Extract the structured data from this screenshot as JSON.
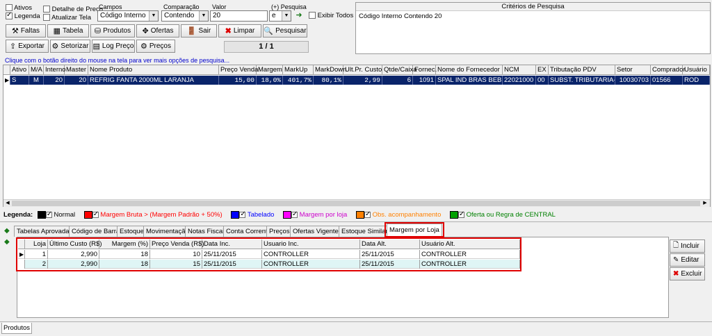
{
  "filters": {
    "ativos": "Ativos",
    "legenda": "Legenda",
    "detalhe_preco": "Detalhe de Preço",
    "atualizar_tela": "Atualizar Tela",
    "campos_label": "Campos",
    "campos_value": "Código Interno",
    "comparacao_label": "Comparação",
    "comparacao_value": "Contendo",
    "valor_label": "Valor",
    "valor_value": "20",
    "pesquisa_label": "(+) Pesquisa",
    "pesquisa_value": "e",
    "exibir_todos": "Exibir Todos"
  },
  "toolbar": {
    "faltas": "Faltas",
    "tabela": "Tabela",
    "produtos": "Produtos",
    "ofertas": "Ofertas",
    "sair": "Sair",
    "limpar": "Limpar",
    "pesquisar": "Pesquisar",
    "exportar": "Exportar",
    "setorizar": "Setorizar",
    "log_preco": "Log Preço",
    "precos": "Preços",
    "page_counter": "1 / 1"
  },
  "criteria": {
    "title": "Critérios de Pesquisa",
    "text": "Código Interno Contendo 20"
  },
  "hint": "Clique com o botão direito do mouse na tela para ver mais opções de pesquisa...",
  "grid": {
    "headers": [
      "Ativo",
      "M/A",
      "Interno",
      "Master",
      "Nome Produto",
      "Preço Venda",
      "Margem",
      "MarkUp",
      "MarkDown",
      "Ult.Pr. Custo",
      "Qtde/Caixa",
      "Fornec.",
      "Nome do Fornecedor",
      "NCM",
      "EX",
      "Tributação PDV",
      "Setor",
      "Comprador",
      "Usuário Inc"
    ],
    "row": [
      "S",
      "M",
      "20",
      "20",
      "REFRIG FANTA 2000ML LARANJA",
      "15,00",
      "18,0%",
      "401,7%",
      "80,1%",
      "2,99",
      "6",
      "1091",
      "SPAL IND BRAS BEBIDA",
      "22021000",
      "00",
      "SUBST. TRIBUTARIA-->",
      "10030703",
      "01566",
      "ROD"
    ]
  },
  "legend": {
    "title": "Legenda:",
    "items": [
      {
        "label": "Normal",
        "color": "#000000",
        "text_color": "#000000"
      },
      {
        "label": "Margem Bruta > (Margem Padrão + 50%)",
        "color": "#ff0000",
        "text_color": "#ff0000"
      },
      {
        "label": "Tabelado",
        "color": "#0000ff",
        "text_color": "#0000ff"
      },
      {
        "label": "Margem por loja",
        "color": "#ff00ff",
        "text_color": "#cc00cc"
      },
      {
        "label": "Obs. acompanhamento",
        "color": "#ff8000",
        "text_color": "#ff8000"
      },
      {
        "label": "Oferta ou Regra de CENTRAL",
        "color": "#00a000",
        "text_color": "#008000"
      }
    ]
  },
  "tabs": [
    "Tabelas Aprovadas",
    "Código de Barras",
    "Estoque",
    "Movimentação",
    "Notas Fiscais",
    "Conta Corrente",
    "Preços",
    "Ofertas Vigentes",
    "Estoque Similares",
    "Margem por Loja"
  ],
  "sub_grid": {
    "headers": [
      "Loja",
      "Último Custo (R$)",
      "Margem (%)",
      "Preço Venda (R$)",
      "Data Inc.",
      "Usuario Inc.",
      "Data Alt.",
      "Usuário Alt."
    ],
    "rows": [
      [
        "1",
        "2,990",
        "18",
        "10",
        "25/11/2015",
        "CONTROLLER",
        "25/11/2015",
        "CONTROLLER"
      ],
      [
        "2",
        "2,990",
        "18",
        "15",
        "25/11/2015",
        "CONTROLLER",
        "25/11/2015",
        "CONTROLLER"
      ]
    ]
  },
  "side_buttons": {
    "incluir": "Incluir",
    "editar": "Editar",
    "excluir": "Excluir"
  },
  "status_tab": "Produtos",
  "colors": {
    "selection": "#0a246a",
    "highlight_border": "#e00000",
    "hint": "#0000cc",
    "row_alt": "#dff5f5"
  }
}
